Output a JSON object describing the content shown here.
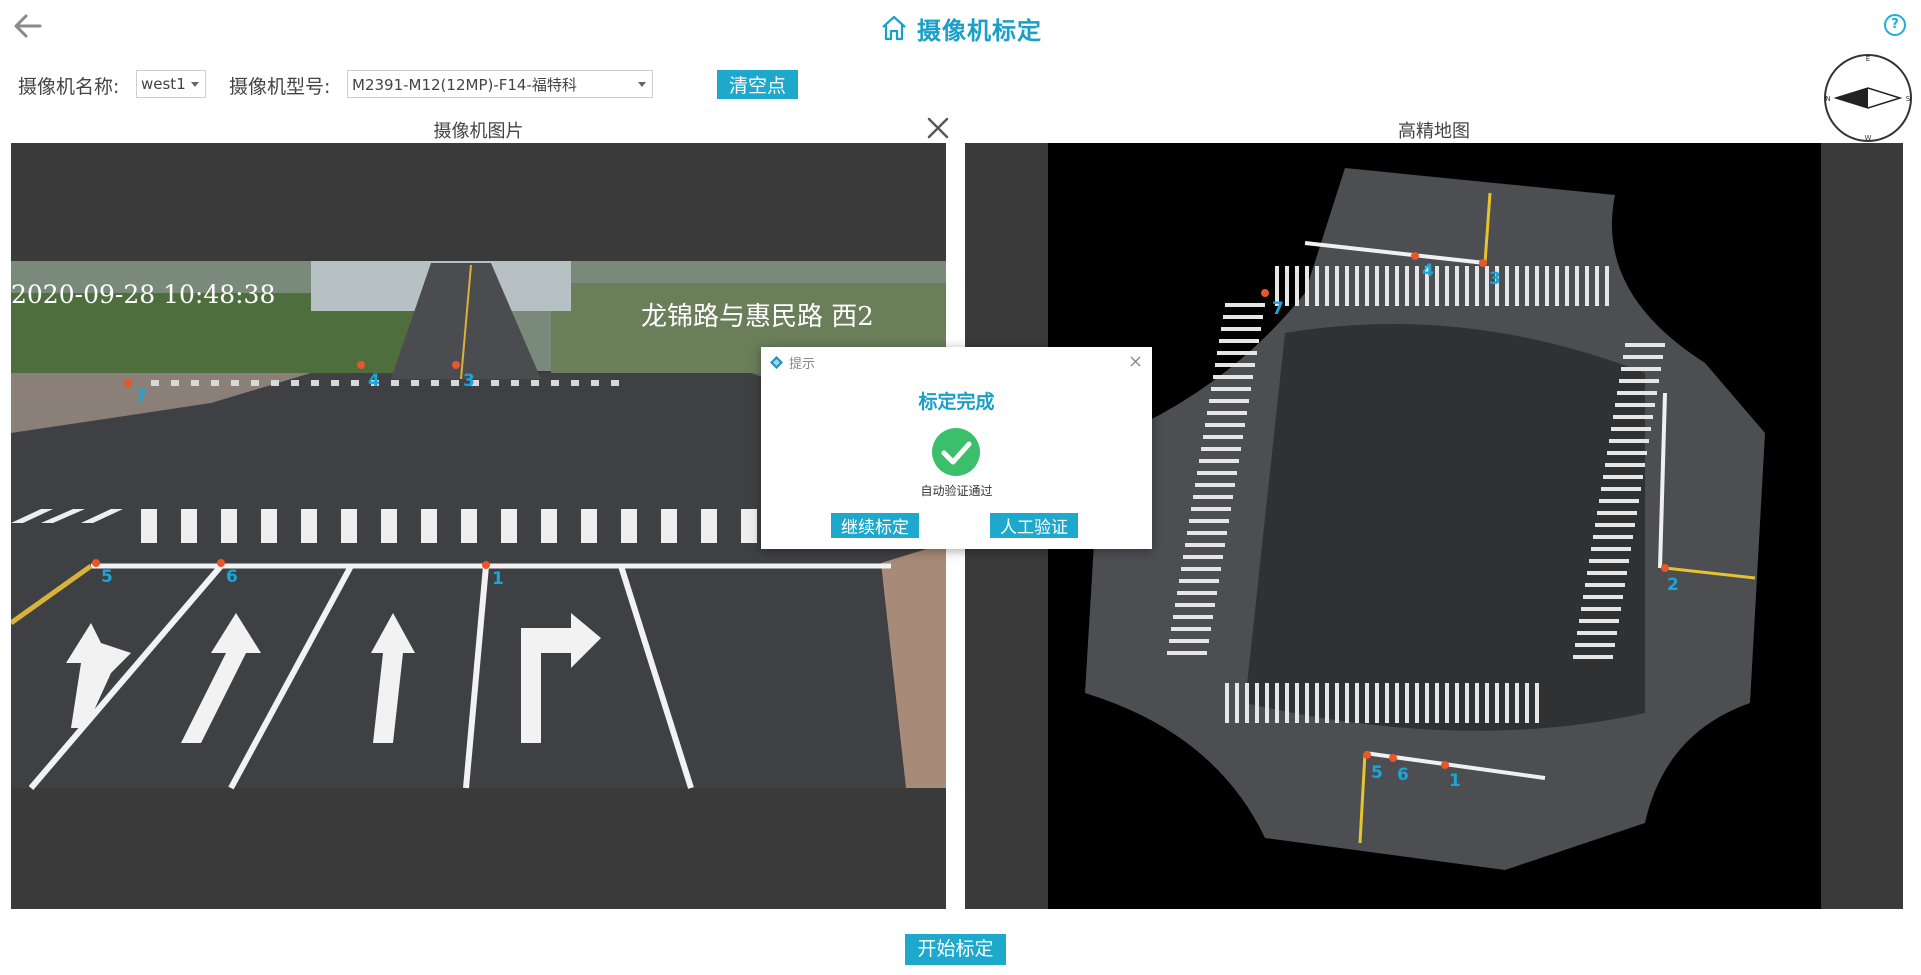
{
  "header": {
    "title": "摄像机标定",
    "help_label": "?"
  },
  "toolbar": {
    "camera_name_label": "摄像机名称:",
    "camera_name_value": "west1",
    "camera_model_label": "摄像机型号:",
    "camera_model_value": "M2391-M12(12MP)-F14-福特科",
    "clear_points_label": "清空点"
  },
  "compass": {
    "n": "N",
    "s": "S",
    "e": "E",
    "w": "W"
  },
  "left_panel": {
    "title": "摄像机图片",
    "timestamp": "2020-09-28 10:48:38",
    "location": "龙锦路与惠民路 西2",
    "points": [
      "7",
      "4",
      "3",
      "5",
      "6",
      "1"
    ]
  },
  "right_panel": {
    "title": "高精地图",
    "points": [
      "7",
      "4",
      "3",
      "2",
      "5",
      "6",
      "1"
    ]
  },
  "dialog": {
    "title": "提示",
    "heading": "标定完成",
    "message": "自动验证通过",
    "continue_label": "继续标定",
    "manual_label": "人工验证"
  },
  "footer": {
    "start_label": "开始标定"
  },
  "colors": {
    "accent": "#1da8cc",
    "point_marker": "#e8562a",
    "point_label": "#19a6dc",
    "success": "#3bbf6a"
  }
}
